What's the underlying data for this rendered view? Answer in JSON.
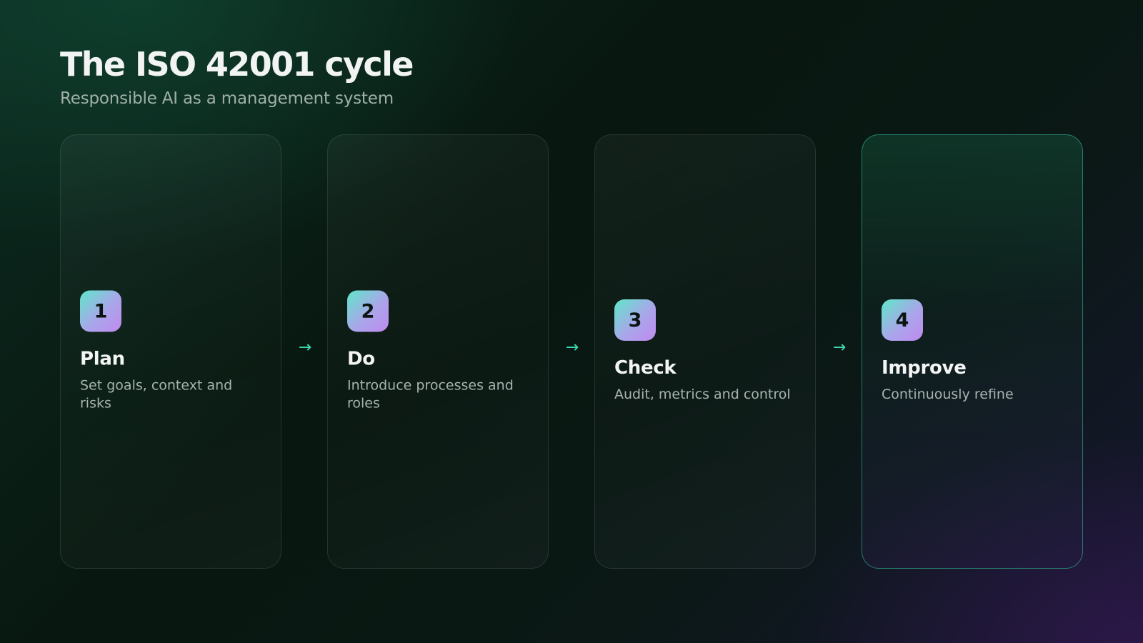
{
  "header": {
    "title": "The ISO 42001 cycle",
    "subtitle": "Responsible AI as a management system"
  },
  "arrow_glyph": "→",
  "steps": [
    {
      "number": "1",
      "title": "Plan",
      "description": "Set goals, context and risks"
    },
    {
      "number": "2",
      "title": "Do",
      "description": "Introduce processes and roles"
    },
    {
      "number": "3",
      "title": "Check",
      "description": "Audit, metrics and control"
    },
    {
      "number": "4",
      "title": "Improve",
      "description": "Continuously refine"
    }
  ],
  "colors": {
    "accent": "#3ddbb4",
    "badge_gradient_start": "#5fe7c9",
    "badge_gradient_end": "#c08af0",
    "highlight_border": "#34c7a5"
  }
}
